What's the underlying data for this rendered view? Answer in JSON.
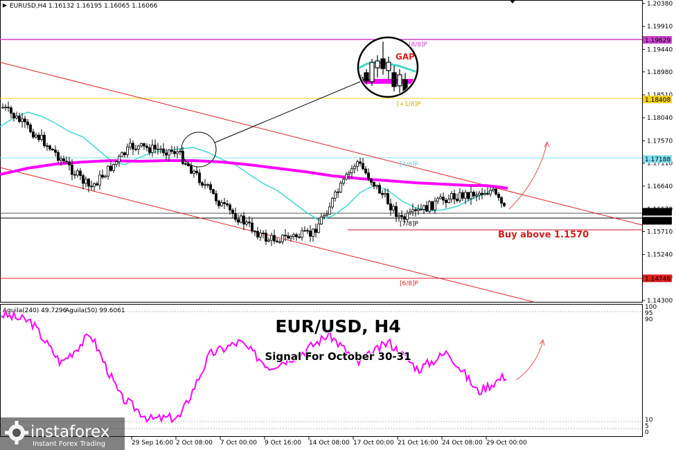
{
  "header": {
    "symbol_line": "EURUSD,H4  1.16132 1.16195 1.16065 1.16066"
  },
  "title": "EUR/USD, H4",
  "subtitle": "Signal For October 30-31",
  "buy_label": "Buy above 1.1570",
  "gap_label": "GAP",
  "colors": {
    "candle": "#000000",
    "ma_fast": "#40d8d0",
    "ma_slow": "#ff00ff",
    "channel": "#e02020",
    "oscillator": "#ff00ff",
    "arrow": "#e85050",
    "level_magenta": "#cc44cc",
    "level_yellow": "#f0d020",
    "level_cyan": "#80e0f0",
    "level_red": "#e02020"
  },
  "indicator": {
    "label1": "Aguila(240) 49.7296",
    "label2": "Aguila(50) 99.6061",
    "ticks": [
      "100",
      "95",
      "90",
      "10",
      "5",
      "0"
    ]
  },
  "price_axis": {
    "ticks": [
      "1.20380",
      "1.19910",
      "1.19440",
      "1.18980",
      "1.18510",
      "1.18040",
      "1.17570",
      "1.17110",
      "1.16640",
      "1.16170",
      "1.15710",
      "1.15240",
      "1.14780",
      "1.14300"
    ],
    "highlight_labels": [
      {
        "text": "1.19629",
        "kind": "magenta"
      },
      {
        "text": "1.18408",
        "kind": "yellow"
      },
      {
        "text": "1.17188",
        "kind": "cyan"
      },
      {
        "text": "1.16066",
        "kind": "dark"
      },
      {
        "text": "1.15967",
        "kind": "dark"
      },
      {
        "text": "1.14746",
        "kind": "red"
      }
    ]
  },
  "murrey_labels": [
    {
      "text": "[8/8]P",
      "kind": "magenta"
    },
    {
      "text": "[+1/8]P",
      "kind": "yellow"
    },
    {
      "text": "[7/8]P",
      "kind": "cyan"
    },
    {
      "text": "[7/8]P",
      "kind": "dark"
    },
    {
      "text": "[6/8]P",
      "kind": "red"
    }
  ],
  "time_axis": [
    "29 Sep 16:00",
    "2 Oct 08:00",
    "7 Oct 00:00",
    "9 Oct 16:00",
    "14 Oct 08:00",
    "17 Oct 00:00",
    "21 Oct 16:00",
    "24 Oct 08:00",
    "29 Oct 00:00"
  ],
  "brand": {
    "name": "instaforex",
    "tagline": "Instant Forex Trading"
  },
  "chart_data": {
    "type": "line",
    "x": [
      "29 Sep 16:00",
      "2 Oct 08:00",
      "7 Oct 00:00",
      "9 Oct 16:00",
      "14 Oct 08:00",
      "17 Oct 00:00",
      "21 Oct 16:00",
      "24 Oct 08:00",
      "29 Oct 00:00"
    ],
    "series": [
      {
        "values": [
          1.1745,
          1.1735,
          1.1625,
          1.1555,
          1.1565,
          1.1715,
          1.1595,
          1.164,
          1.1607
        ]
      }
    ],
    "ylim": [
      1.143,
      1.2038
    ],
    "levels": [
      1.19629,
      1.18408,
      1.17188,
      1.16066,
      1.15967,
      1.14746,
      1.157
    ],
    "indicator_values": [
      94,
      88,
      55,
      78,
      28,
      10,
      12,
      62,
      72,
      52,
      62,
      78,
      55,
      72,
      50,
      64,
      32,
      46
    ],
    "indicator_ylim": [
      0,
      100
    ]
  }
}
